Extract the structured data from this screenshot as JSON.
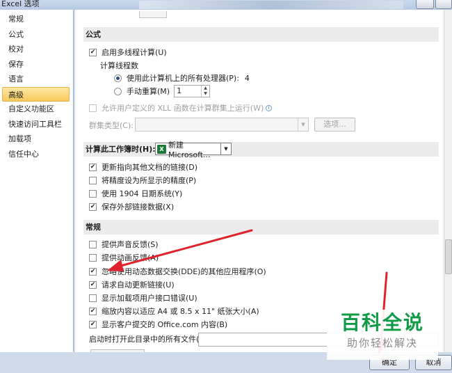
{
  "window": {
    "title": "Excel 选项"
  },
  "sidebar": {
    "items": [
      {
        "label": "常规"
      },
      {
        "label": "公式"
      },
      {
        "label": "校对"
      },
      {
        "label": "保存"
      },
      {
        "label": "语言"
      },
      {
        "label": "高级",
        "selected": true
      },
      {
        "label": "自定义功能区"
      },
      {
        "label": "快速访问工具栏"
      },
      {
        "label": "加载项"
      },
      {
        "label": "信任中心"
      }
    ]
  },
  "formulas": {
    "section_title": "公式",
    "multithread_label": "启用多线程计算(U)",
    "multithread_checked": true,
    "threads_label": "计算线程数",
    "use_all_label": "使用此计算机上的所有处理器(P):",
    "use_all_value": "4",
    "use_all_selected": true,
    "manual_label": "手动重算(M)",
    "manual_value": "1",
    "xll_label": "允许用户定义的 XLL 函数在计算群集上运行(W)",
    "xll_checked": false,
    "cluster_label": "群集类型(C):",
    "options_button": "选项..."
  },
  "workbook_calc": {
    "section_title": "计算此工作簿时(H):",
    "workbook_value": "新建 Microsoft...",
    "options": [
      {
        "label": "更新指向其他文档的链接(D)",
        "checked": true
      },
      {
        "label": "将精度设为所显示的精度(P)",
        "checked": false
      },
      {
        "label": "使用 1904 日期系统(Y)",
        "checked": false
      },
      {
        "label": "保存外部链接数据(X)",
        "checked": true
      }
    ]
  },
  "general": {
    "section_title": "常规",
    "options": [
      {
        "label": "提供声音反馈(S)",
        "checked": false
      },
      {
        "label": "提供动画反馈(A)",
        "checked": false
      },
      {
        "label": "忽略使用动态数据交换(DDE)的其他应用程序(O)",
        "checked": true
      },
      {
        "label": "请求自动更新链接(U)",
        "checked": true
      },
      {
        "label": "显示加载项用户接口错误(U)",
        "checked": false
      },
      {
        "label": "缩放内容以适应 A4 或 8.5 x 11\" 纸张大小(A)",
        "checked": true
      },
      {
        "label": "显示客户提交的 Office.com 内容(B)",
        "checked": true
      }
    ],
    "startup_label": "启动时打开此目录中的所有文件(L):"
  },
  "footer": {
    "ok_label": "确定",
    "cancel_label": "取消"
  },
  "watermark": {
    "line1": "百科全说",
    "line2": "助你轻松解决"
  },
  "colors": {
    "accent_selected": "#f7c85a",
    "annotation_red": "#e0232a",
    "watermark_green": "#0f9b46"
  }
}
